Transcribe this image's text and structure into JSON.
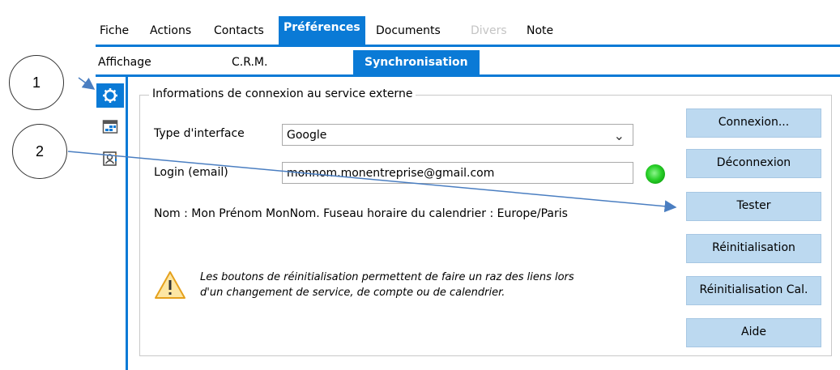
{
  "tabs": [
    {
      "label": "Fiche"
    },
    {
      "label": "Actions"
    },
    {
      "label": "Contacts"
    },
    {
      "label": "Préférences",
      "active": true
    },
    {
      "label": "Documents"
    },
    {
      "label": "Divers",
      "disabled": true
    },
    {
      "label": "Note"
    }
  ],
  "subtabs": [
    {
      "label": "Affichage"
    },
    {
      "label": "C.R.M."
    },
    {
      "label": "Synchronisation",
      "active": true
    }
  ],
  "sidebar_icons": [
    "gear-icon",
    "calendar-icon",
    "contact-card-icon"
  ],
  "group": {
    "title": "Informations  de connexion au service externe",
    "interface_label": "Type d'interface",
    "interface_value": "Google",
    "login_label": "Login (email)",
    "login_value": "monnom.monentreprise@gmail.com",
    "info_text": "Nom : Mon Prénom MonNom. Fuseau horaire du calendrier : Europe/Paris",
    "note_line1": "Les boutons de réinitialisation permettent de faire un raz des liens lors",
    "note_line2": "d'un changement de service, de compte ou de calendrier."
  },
  "buttons": {
    "connexion": "Connexion...",
    "deconnexion": "Déconnexion",
    "tester": "Tester",
    "reinit": "Réinitialisation",
    "reinit_cal": "Réinitialisation Cal.",
    "aide": "Aide"
  },
  "status_color": "#2bd12b",
  "accent_color": "#0a7ad6",
  "button_color": "#bcd9f0",
  "callouts": [
    "1",
    "2"
  ]
}
